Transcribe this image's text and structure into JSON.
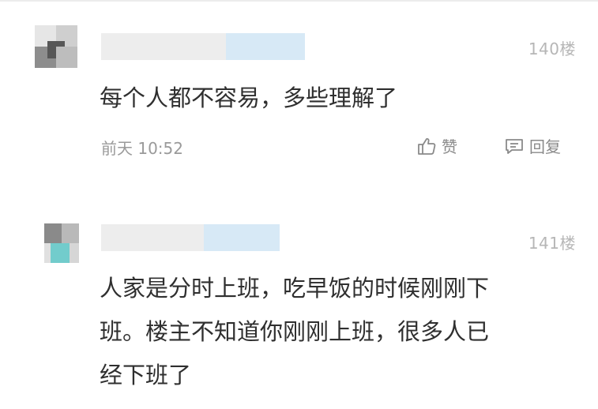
{
  "comments": [
    {
      "floor": "140楼",
      "content": "每个人都不容易，多些理解了",
      "time": "前天 10:52",
      "like_label": "赞",
      "reply_label": "回复",
      "avatar_colors": [
        "#dcdcdc",
        "#b9b9b9",
        "#5a5a5a",
        "#8d8d8d",
        "#cfcfcf",
        "#f0f0f0"
      ]
    },
    {
      "floor": "141楼",
      "content": "人家是分时上班，吃早饭的时候刚刚下班。楼主不知道你刚刚上班，很多人已经下班了",
      "content_lines": [
        "人家是分时上班，吃早饭的时候刚刚下",
        "班。楼主不知道你刚刚上班，很多人已",
        "经下班了"
      ],
      "avatar_colors": [
        "#8a8a8a",
        "#b6b6b6",
        "#6fc9c9",
        "#d9d9d9",
        "#a9a9a9",
        "#ececec"
      ]
    }
  ],
  "icons": {
    "like": "thumbs-up-icon",
    "reply": "comment-bubble-icon"
  }
}
